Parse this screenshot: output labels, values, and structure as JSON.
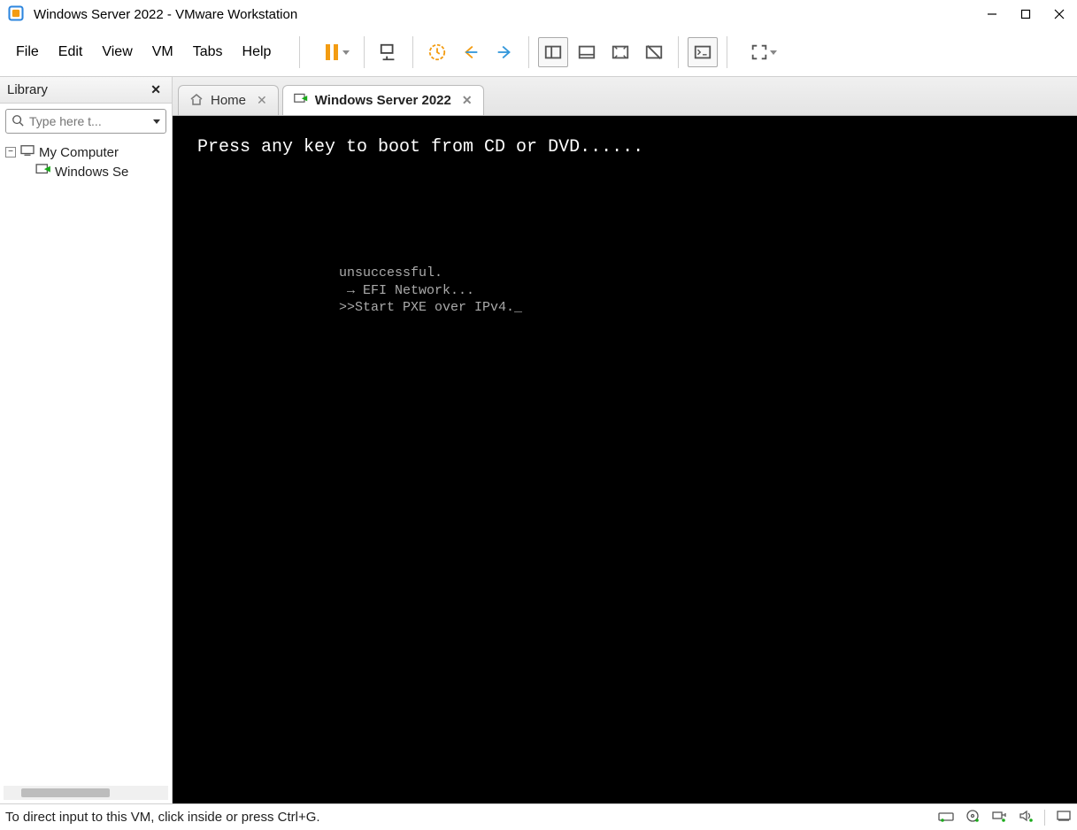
{
  "window": {
    "title": "Windows Server 2022 - VMware Workstation"
  },
  "menu": {
    "items": [
      "File",
      "Edit",
      "View",
      "VM",
      "Tabs",
      "Help"
    ]
  },
  "library": {
    "title": "Library",
    "search_placeholder": "Type here t...",
    "root": "My Computer",
    "vm_item": "Windows Se"
  },
  "tabs": {
    "home": "Home",
    "active": "Windows Server 2022"
  },
  "console": {
    "line1": "Press any key to boot from CD or DVD......",
    "line2": "unsuccessful.",
    "line3": " → EFI Network...",
    "line4": ">>Start PXE over IPv4._"
  },
  "status": {
    "text": "To direct input to this VM, click inside or press Ctrl+G."
  }
}
